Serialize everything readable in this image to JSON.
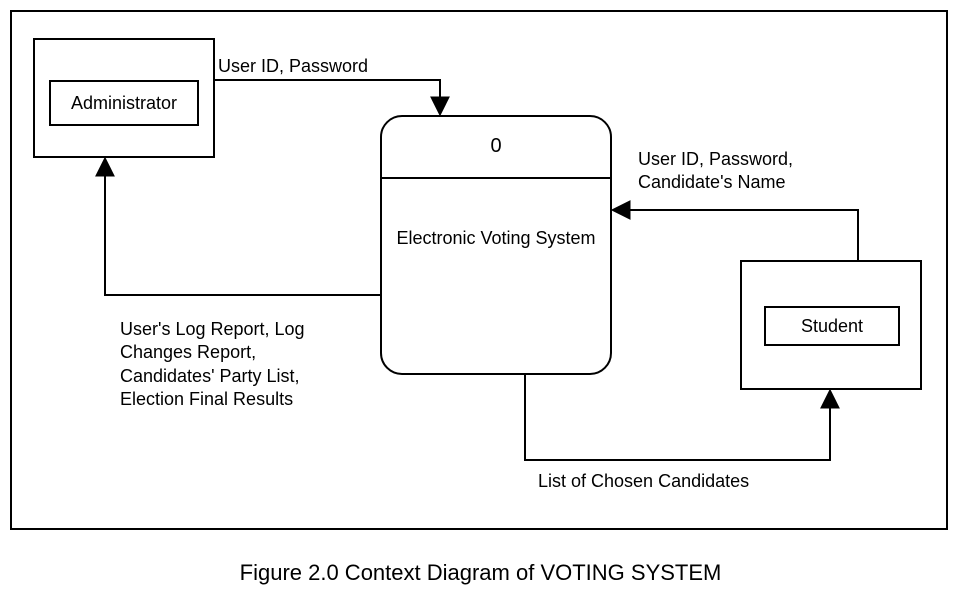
{
  "entities": {
    "administrator": {
      "label": "Administrator"
    },
    "student": {
      "label": "Student"
    }
  },
  "process": {
    "number": "0",
    "name": "Electronic Voting\nSystem"
  },
  "flows": {
    "admin_to_process": "User ID, Password",
    "process_to_admin": "User's Log Report, Log\nChanges Report,\nCandidates' Party List,\nElection Final Results",
    "student_to_process": "User ID, Password,\nCandidate's Name",
    "process_to_student": "List of Chosen Candidates"
  },
  "caption": "Figure 2.0 Context Diagram of VOTING SYSTEM"
}
